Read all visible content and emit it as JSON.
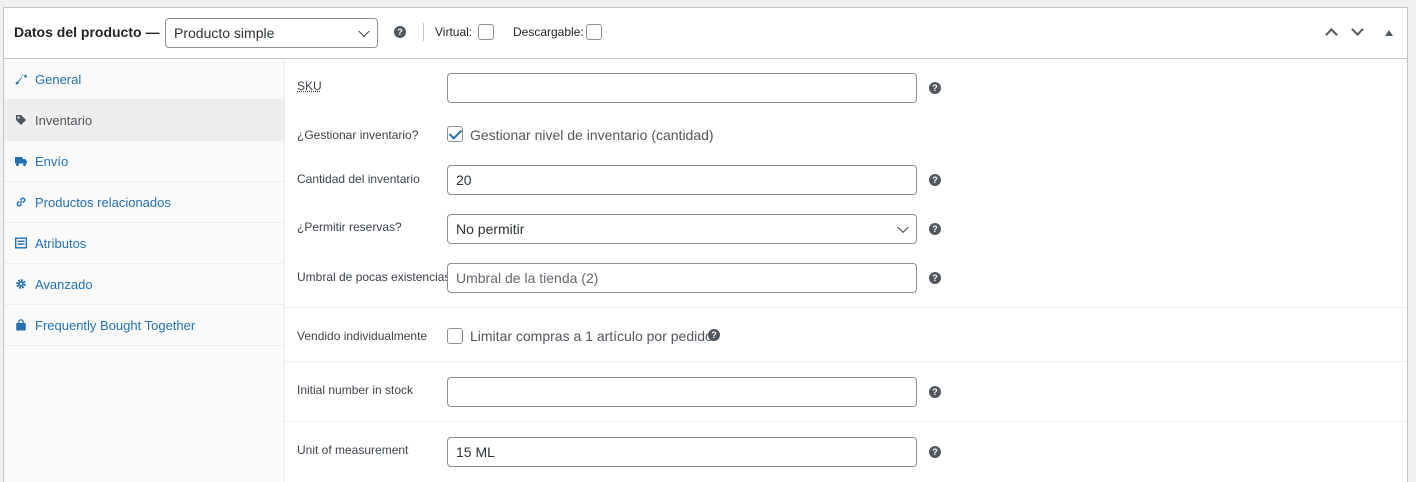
{
  "header": {
    "title": "Datos del producto —",
    "product_type": "Producto simple",
    "virtual_label": "Virtual:",
    "downloadable_label": "Descargable:"
  },
  "tabs": [
    {
      "label": "General",
      "icon": "wrench-icon",
      "active": false
    },
    {
      "label": "Inventario",
      "icon": "tag-icon",
      "active": true
    },
    {
      "label": "Envío",
      "icon": "truck-icon",
      "active": false
    },
    {
      "label": "Productos relacionados",
      "icon": "link-icon",
      "active": false
    },
    {
      "label": "Atributos",
      "icon": "list-icon",
      "active": false
    },
    {
      "label": "Avanzado",
      "icon": "gear-icon",
      "active": false
    },
    {
      "label": "Frequently Bought Together",
      "icon": "bag-icon",
      "active": false
    }
  ],
  "form": {
    "sku_label": "SKU",
    "sku_value": "",
    "manage_label": "¿Gestionar inventario?",
    "manage_checkbox": "Gestionar nivel de inventario (cantidad)",
    "qty_label": "Cantidad del inventario",
    "qty_value": "20",
    "backorders_label": "¿Permitir reservas?",
    "backorders_value": "No permitir",
    "low_stock_label": "Umbral de pocas existencias",
    "low_stock_placeholder": "Umbral de la tienda (2)",
    "sold_ind_label": "Vendido individualmente",
    "sold_ind_checkbox": "Limitar compras a 1 artículo por pedido",
    "initial_label": "Initial number in stock",
    "initial_value": "",
    "unit_label": "Unit of measurement",
    "unit_value": "15 ML"
  },
  "colors": {
    "link": "#2271b1",
    "active_tab_bg": "#eeeeee",
    "border": "#c3c4c7"
  }
}
